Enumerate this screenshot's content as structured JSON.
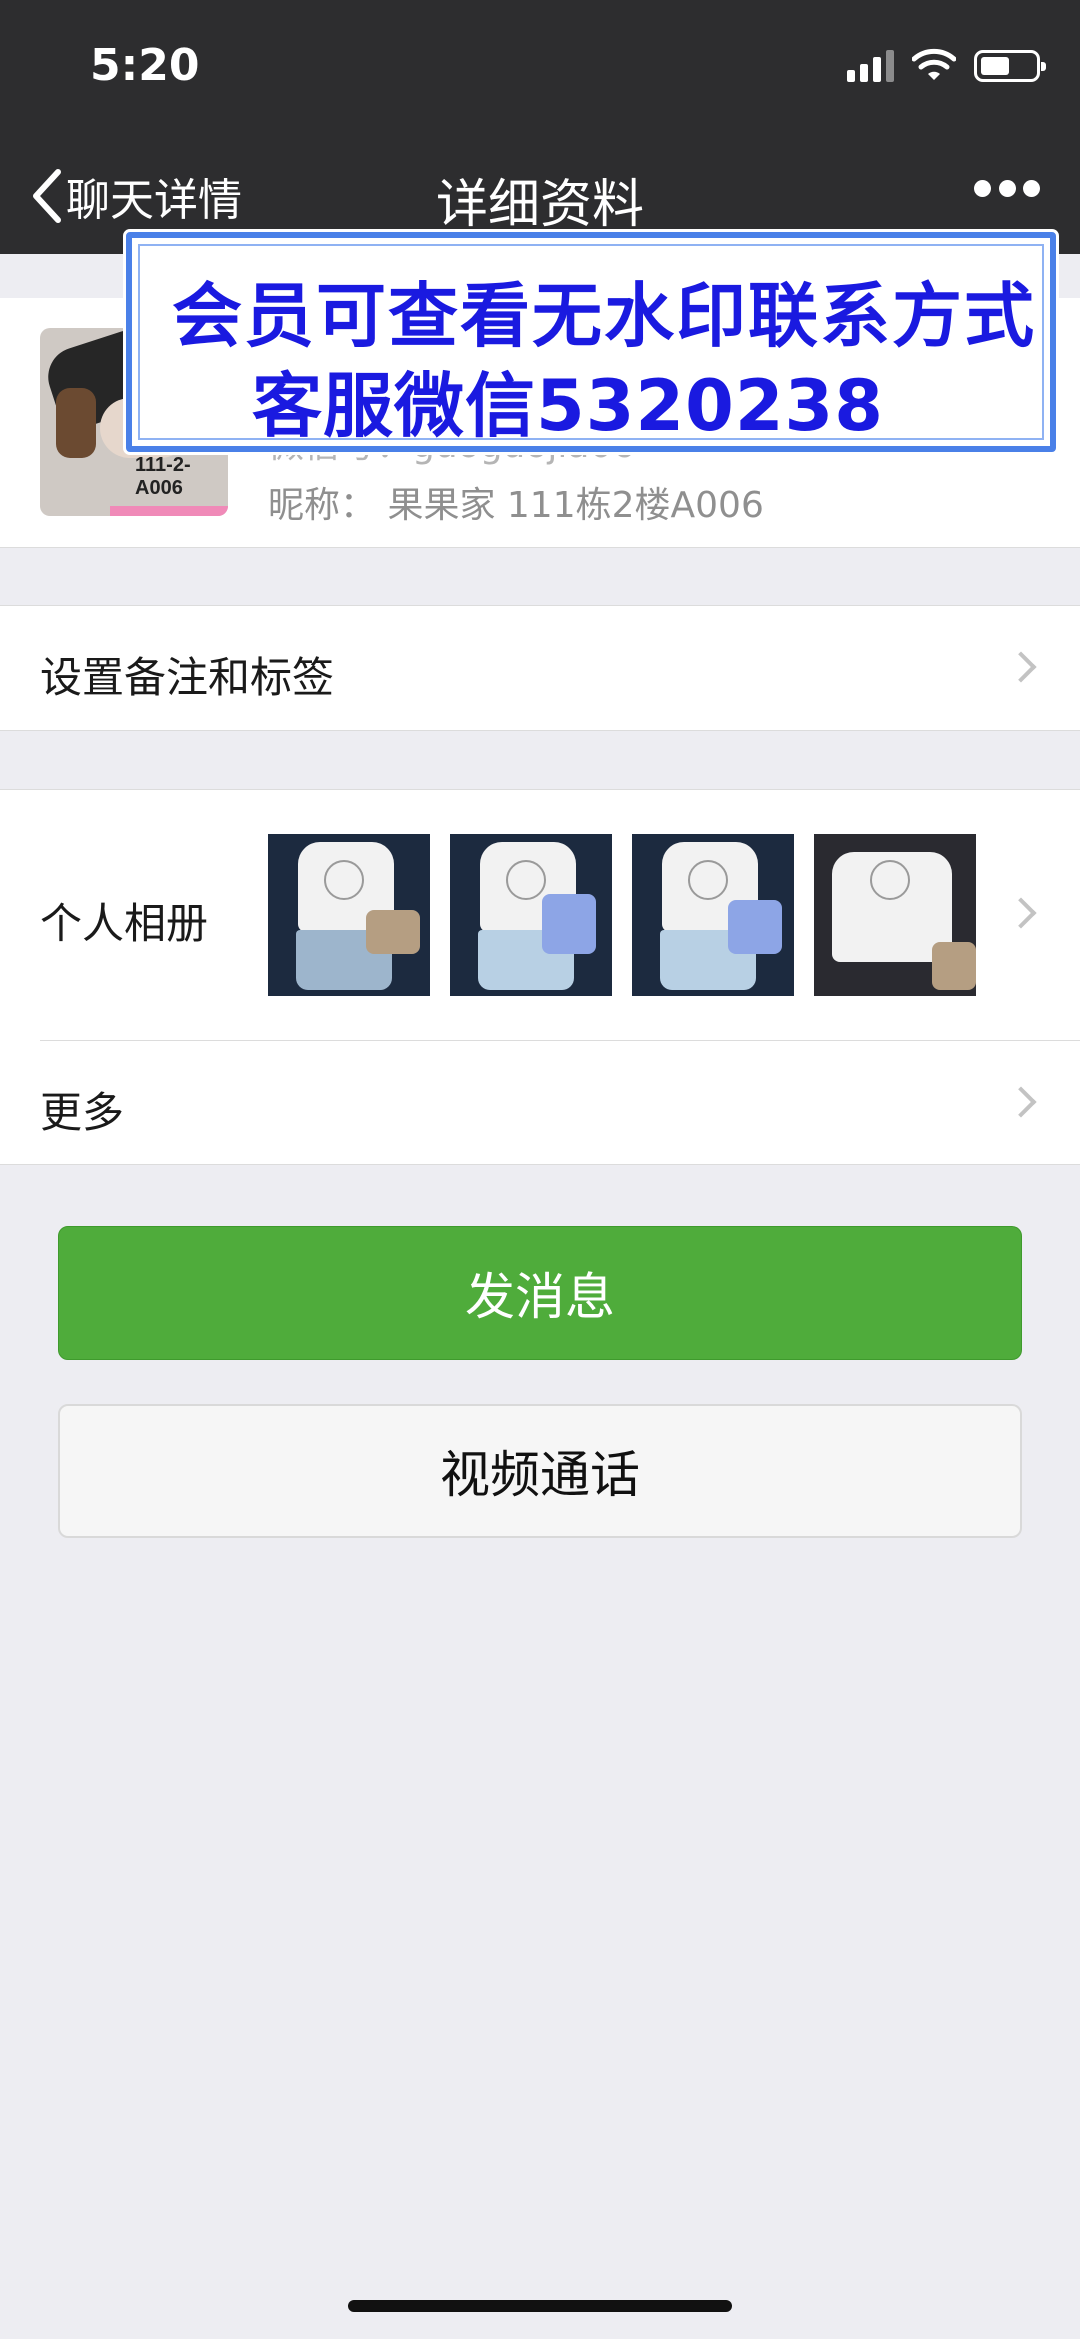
{
  "status_bar": {
    "time": "5:20"
  },
  "nav": {
    "back_label": "聊天详情",
    "title": "详细资料"
  },
  "profile": {
    "avatar_label": "111-2-A006",
    "wechat_id": "微信号：guoguojia06",
    "nickname": "昵称：  果果家 111栋2楼A006"
  },
  "overlay": {
    "line1": "会员可查看无水印联系方式",
    "line2": "客服微信5320238"
  },
  "rows": {
    "remark": "设置备注和标签",
    "album": "个人相册",
    "more": "更多"
  },
  "album_photos": [
    "photo-1",
    "photo-2",
    "photo-3",
    "photo-4"
  ],
  "buttons": {
    "send": "发消息",
    "video": "视频通话"
  },
  "colors": {
    "nav_bg": "#2d2d2f",
    "send_green": "#4fac3b",
    "overlay_text": "#1a1ae0",
    "overlay_border": "#4a80e8"
  }
}
